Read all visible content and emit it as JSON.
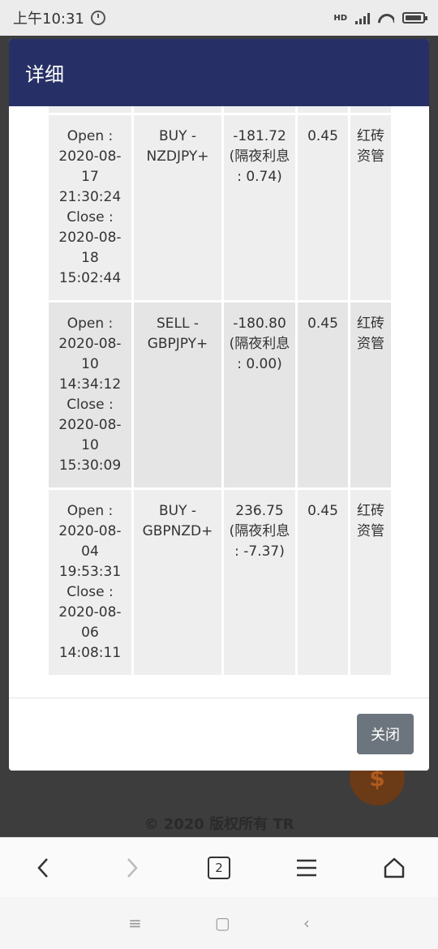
{
  "status_bar": {
    "time": "上午10:31",
    "network": "HD"
  },
  "modal": {
    "title": "详细",
    "close_label": "关闭",
    "rows": [
      {
        "time": "Open : 2020-08-17 21:30:24 Close : 2020-08-18 15:02:44",
        "symbol": "BUY - NZDJPY+",
        "profit": "-181.72 (隔夜利息 : 0.74)",
        "lots": "0.45",
        "broker": "红砖资管"
      },
      {
        "time": "Open : 2020-08-10 14:34:12 Close : 2020-08-10 15:30:09",
        "symbol": "SELL - GBPJPY+",
        "profit": "-180.80 (隔夜利息 : 0.00)",
        "lots": "0.45",
        "broker": "红砖资管"
      },
      {
        "time": "Open : 2020-08-04 19:53:31 Close : 2020-08-06 14:08:11",
        "symbol": "BUY - GBPNZD+",
        "profit": "236.75 (隔夜利息 : -7.37)",
        "lots": "0.45",
        "broker": "红砖资管"
      }
    ]
  },
  "background": {
    "copyright": "© 2020 版权所有 TR",
    "fab_symbol": "$"
  },
  "browser_toolbar": {
    "back": "‹",
    "forward": "›",
    "tab_count": "2",
    "menu": "≡",
    "home": "⌂"
  },
  "system_nav": {
    "menu": "≡",
    "home": "▢",
    "back": "‹"
  }
}
